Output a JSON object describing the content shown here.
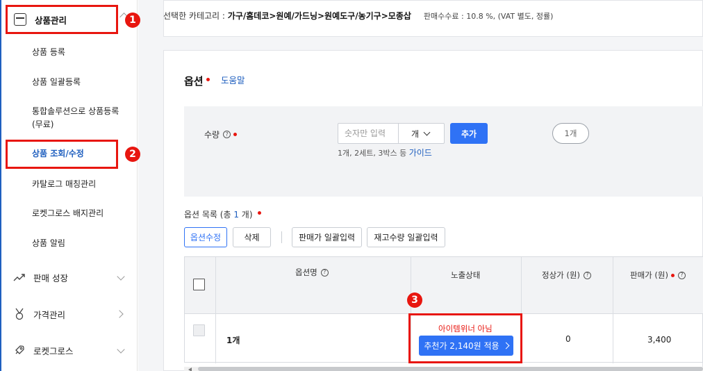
{
  "sidebar": {
    "top_item": "상품관리",
    "sub_items": [
      "상품 등록",
      "상품 일괄등록",
      "통합솔루션으로 상품등록",
      "(무료)",
      "상품 조회/수정",
      "카탈로그 매칭관리",
      "로켓그로스 배지관리",
      "상품 알림"
    ],
    "main_items": [
      {
        "label": "판매 성장",
        "icon": "trend-icon"
      },
      {
        "label": "가격관리",
        "icon": "medal-icon"
      },
      {
        "label": "로켓그로스",
        "icon": "rocket-icon"
      }
    ]
  },
  "annotations": {
    "badge1": "1",
    "badge2": "2",
    "badge3": "3"
  },
  "category": {
    "prefix": "선택한 카테고리 : ",
    "path": "가구/홈데코>원예/가드닝>원예도구/농기구>모종삽",
    "fee": "판매수수료 : 10.8 %, (VAT 별도, 정률)"
  },
  "options": {
    "title": "옵션",
    "help": "도움말",
    "qty_label": "수량",
    "qty_placeholder": "숫자만 입력",
    "unit": "개",
    "add": "추가",
    "hint_prefix": "1개, 2세트, 3박스 등 ",
    "hint_link": "가이드",
    "chip": "1개",
    "list_prefix": "옵션 목록 (총 ",
    "list_count": "1",
    "list_suffix": " 개)",
    "buttons": [
      "옵션수정",
      "삭제",
      "판매가 일괄입력",
      "재고수량 일괄입력"
    ]
  },
  "table": {
    "headers": [
      "옵션명",
      "노출상태",
      "정상가 (원)",
      "판매가 (원)"
    ],
    "row": {
      "name": "1개",
      "status": "아이템위너 아님",
      "recommend": "추천가 2,140원 적용",
      "normal_price": "0",
      "sale_price": "3,400"
    }
  },
  "colors": {
    "accent": "#2f72f5",
    "annotation_red": "#e8160f",
    "link": "#1f5fbf"
  }
}
